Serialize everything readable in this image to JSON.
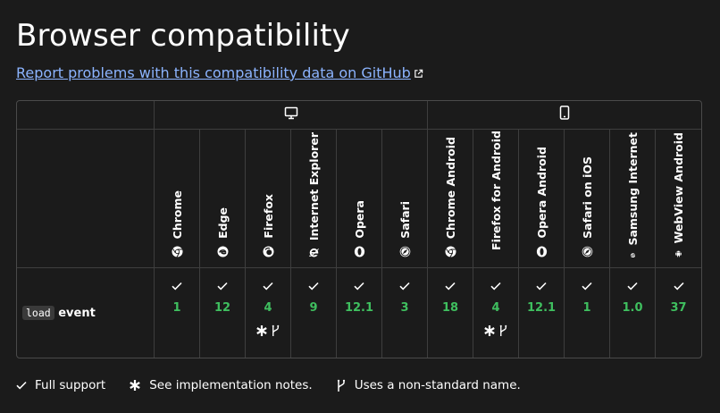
{
  "page": {
    "title": "Browser compatibility",
    "report_link": "Report problems with this compatibility data on GitHub"
  },
  "platforms": [
    {
      "name": "desktop",
      "icon": "desktop-icon"
    },
    {
      "name": "mobile",
      "icon": "mobile-icon"
    }
  ],
  "browsers": [
    {
      "name": "Chrome",
      "icon": "chrome-icon"
    },
    {
      "name": "Edge",
      "icon": "edge-icon"
    },
    {
      "name": "Firefox",
      "icon": "firefox-icon"
    },
    {
      "name": "Internet Explorer",
      "icon": "ie-icon"
    },
    {
      "name": "Opera",
      "icon": "opera-icon"
    },
    {
      "name": "Safari",
      "icon": "safari-icon"
    },
    {
      "name": "Chrome Android",
      "icon": "chrome-icon"
    },
    {
      "name": "Firefox for Android",
      "icon": "firefox-icon"
    },
    {
      "name": "Opera Android",
      "icon": "opera-icon"
    },
    {
      "name": "Safari on iOS",
      "icon": "safari-icon"
    },
    {
      "name": "Samsung Internet",
      "icon": "samsung-icon"
    },
    {
      "name": "WebView Android",
      "icon": "android-icon"
    }
  ],
  "feature": {
    "code": "load",
    "suffix": "event",
    "support": [
      {
        "version": "1",
        "status": "full",
        "notes": false
      },
      {
        "version": "12",
        "status": "full",
        "notes": false
      },
      {
        "version": "4",
        "status": "full",
        "notes": true
      },
      {
        "version": "9",
        "status": "full",
        "notes": false
      },
      {
        "version": "12.1",
        "status": "full",
        "notes": false
      },
      {
        "version": "3",
        "status": "full",
        "notes": false
      },
      {
        "version": "18",
        "status": "full",
        "notes": false
      },
      {
        "version": "4",
        "status": "full",
        "notes": true
      },
      {
        "version": "12.1",
        "status": "full",
        "notes": false
      },
      {
        "version": "1",
        "status": "full",
        "notes": false
      },
      {
        "version": "1.0",
        "status": "full",
        "notes": false
      },
      {
        "version": "37",
        "status": "full",
        "notes": false
      }
    ]
  },
  "legend": {
    "full_support": "Full support",
    "impl_notes": "See implementation notes.",
    "non_standard": "Uses a non-standard name."
  },
  "colors": {
    "background": "#1b1b1b",
    "link": "#8cb4ff",
    "supported": "#3fbf5f",
    "border": "#3e3e3e"
  }
}
